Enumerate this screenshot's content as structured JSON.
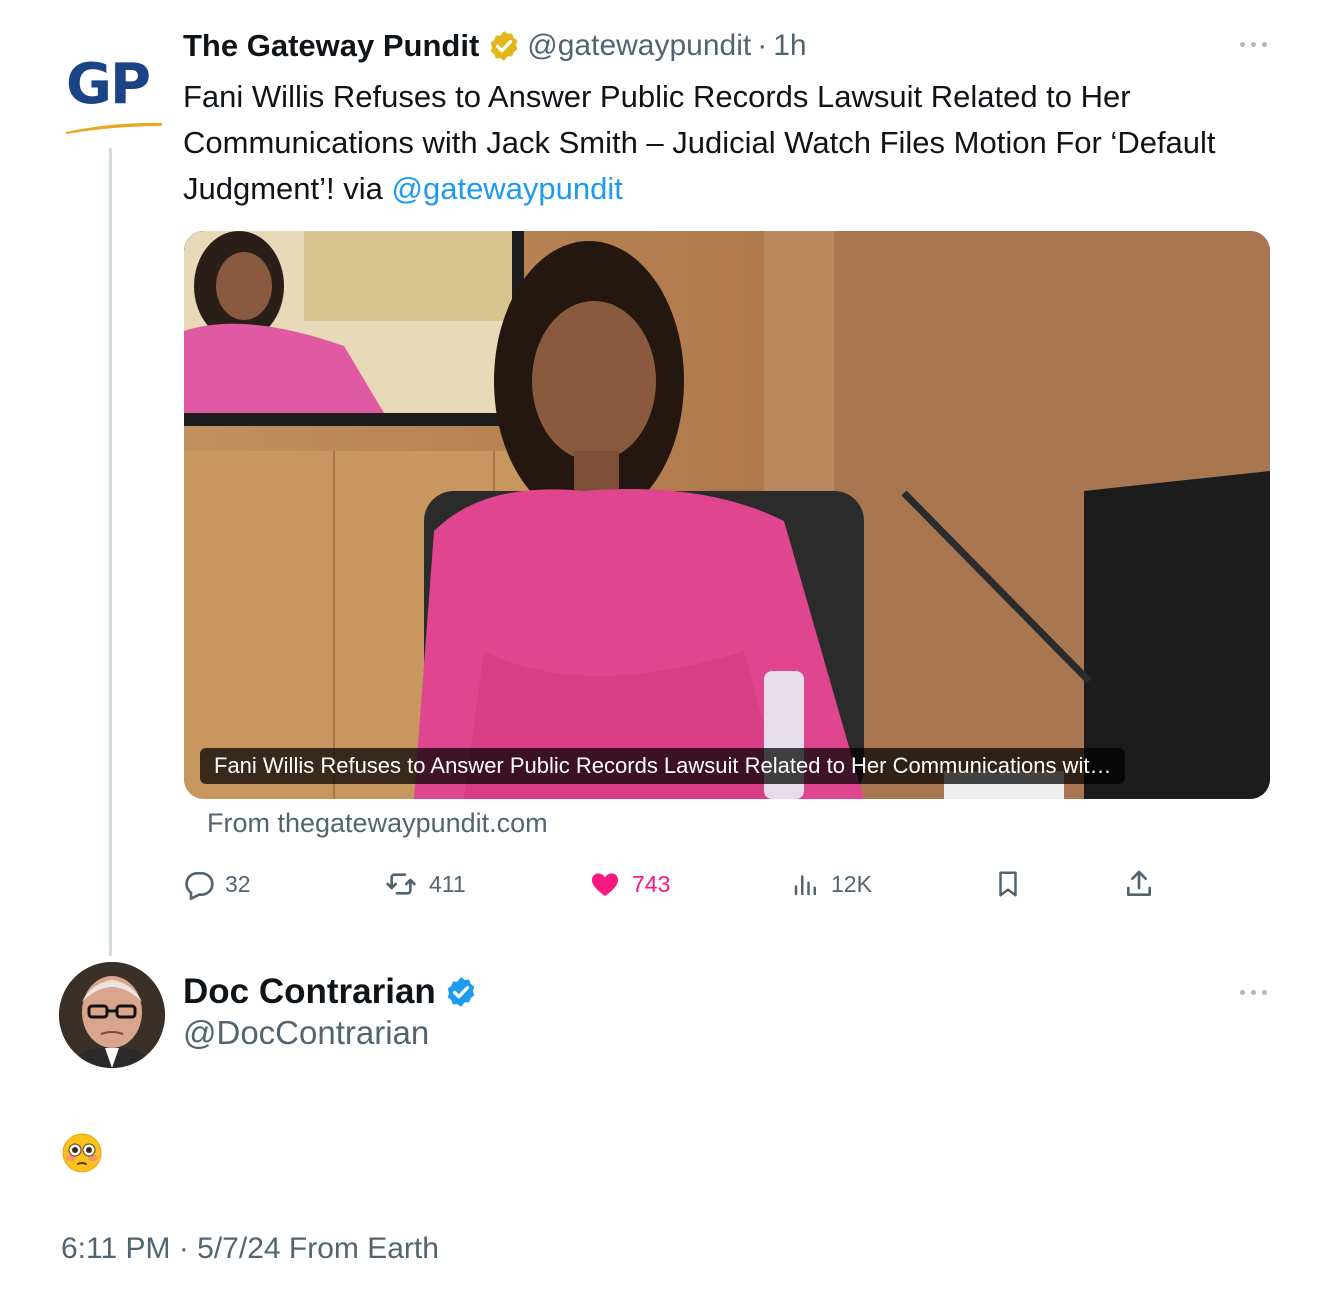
{
  "quoted": {
    "logo_text": "GP",
    "name": "The Gateway Pundit",
    "handle": "@gatewaypundit",
    "separator": "·",
    "time": "1h",
    "text_before": "Fani Willis Refuses to Answer Public Records Lawsuit Related to Her Communications with Jack Smith – Judicial Watch Files Motion For ‘Default Judgment’! via ",
    "mention": "@gatewaypundit",
    "card_caption": "Fani Willis Refuses to Answer Public Records Lawsuit Related to Her Communications wit…",
    "card_source": "From thegatewaypundit.com",
    "metrics": {
      "replies": "32",
      "reposts": "411",
      "likes": "743",
      "views": "12K"
    },
    "verified_color": "#e2b719"
  },
  "tweet": {
    "name": "Doc Contrarian",
    "handle": "@DocContrarian",
    "body_emoji": "flushed-face-emoji",
    "timestamp": "6:11 PM · 5/7/24 From Earth",
    "verified_color": "#1d9bf0"
  },
  "colors": {
    "accent": "#1d9bf0",
    "like": "#f91880",
    "muted": "#536471"
  }
}
